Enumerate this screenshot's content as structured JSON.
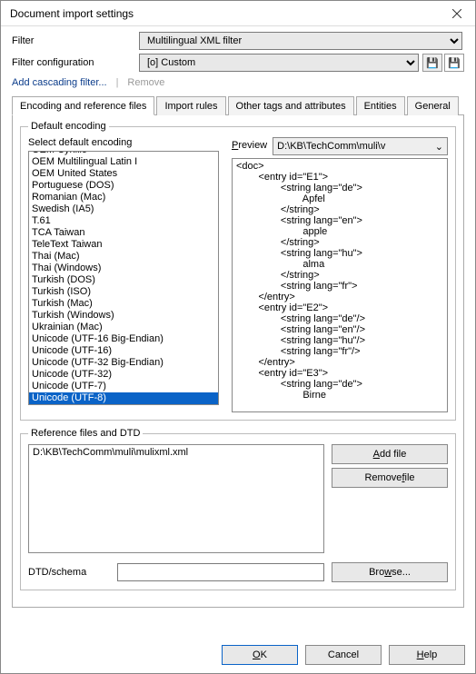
{
  "window": {
    "title": "Document import settings"
  },
  "filter": {
    "label": "Filter",
    "value": "Multilingual XML filter",
    "config_label": "Filter configuration",
    "config_value": "[o] Custom"
  },
  "links": {
    "add_cascading": "Add cascading filter...",
    "remove": "Remove"
  },
  "tabs": {
    "encoding": "Encoding and reference files",
    "import_rules": "Import rules",
    "other_tags": "Other tags and attributes",
    "entities": "Entities",
    "general": "General"
  },
  "default_encoding": {
    "legend": "Default encoding",
    "select_label_pre": "Select default encoding",
    "preview_label_pre": "P",
    "preview_label_post": "review",
    "preview_path": "D:\\KB\\TechComm\\muli\\v",
    "encodings": [
      "OEM Cyrillic",
      "OEM Multilingual Latin I",
      "OEM United States",
      "Portuguese (DOS)",
      "Romanian (Mac)",
      "Swedish (IA5)",
      "T.61",
      "TCA Taiwan",
      "TeleText Taiwan",
      "Thai (Mac)",
      "Thai (Windows)",
      "Turkish (DOS)",
      "Turkish (ISO)",
      "Turkish (Mac)",
      "Turkish (Windows)",
      "Ukrainian (Mac)",
      "Unicode (UTF-16 Big-Endian)",
      "Unicode (UTF-16)",
      "Unicode (UTF-32 Big-Endian)",
      "Unicode (UTF-32)",
      "Unicode (UTF-7)",
      "Unicode (UTF-8)"
    ],
    "selected": "Unicode (UTF-8)",
    "preview_xml": "<doc>\n        <entry id=\"E1\">\n                <string lang=\"de\">\n                        Apfel\n                </string>\n                <string lang=\"en\">\n                        apple\n                </string>\n                <string lang=\"hu\">\n                        alma\n                </string>\n                <string lang=\"fr\">\n        </entry>\n        <entry id=\"E2\">\n                <string lang=\"de\"/>\n                <string lang=\"en\"/>\n                <string lang=\"hu\"/>\n                <string lang=\"fr\"/>\n        </entry>\n        <entry id=\"E3\">\n                <string lang=\"de\">\n                        Birne"
  },
  "reference": {
    "legend": "Reference files and DTD",
    "files": [
      "D:\\KB\\TechComm\\muli\\mulixml.xml"
    ],
    "add_pre": "A",
    "add_post": "dd file",
    "remove_pre": "Remove ",
    "remove_u": "f",
    "remove_post": "ile",
    "dtd_label_pre": "D",
    "dtd_label_post": "TD/schema",
    "dtd_value": "",
    "browse_pre": "Bro",
    "browse_u": "w",
    "browse_post": "se..."
  },
  "footer": {
    "ok_u": "O",
    "ok_post": "K",
    "cancel": "Cancel",
    "help_u": "H",
    "help_post": "elp"
  }
}
